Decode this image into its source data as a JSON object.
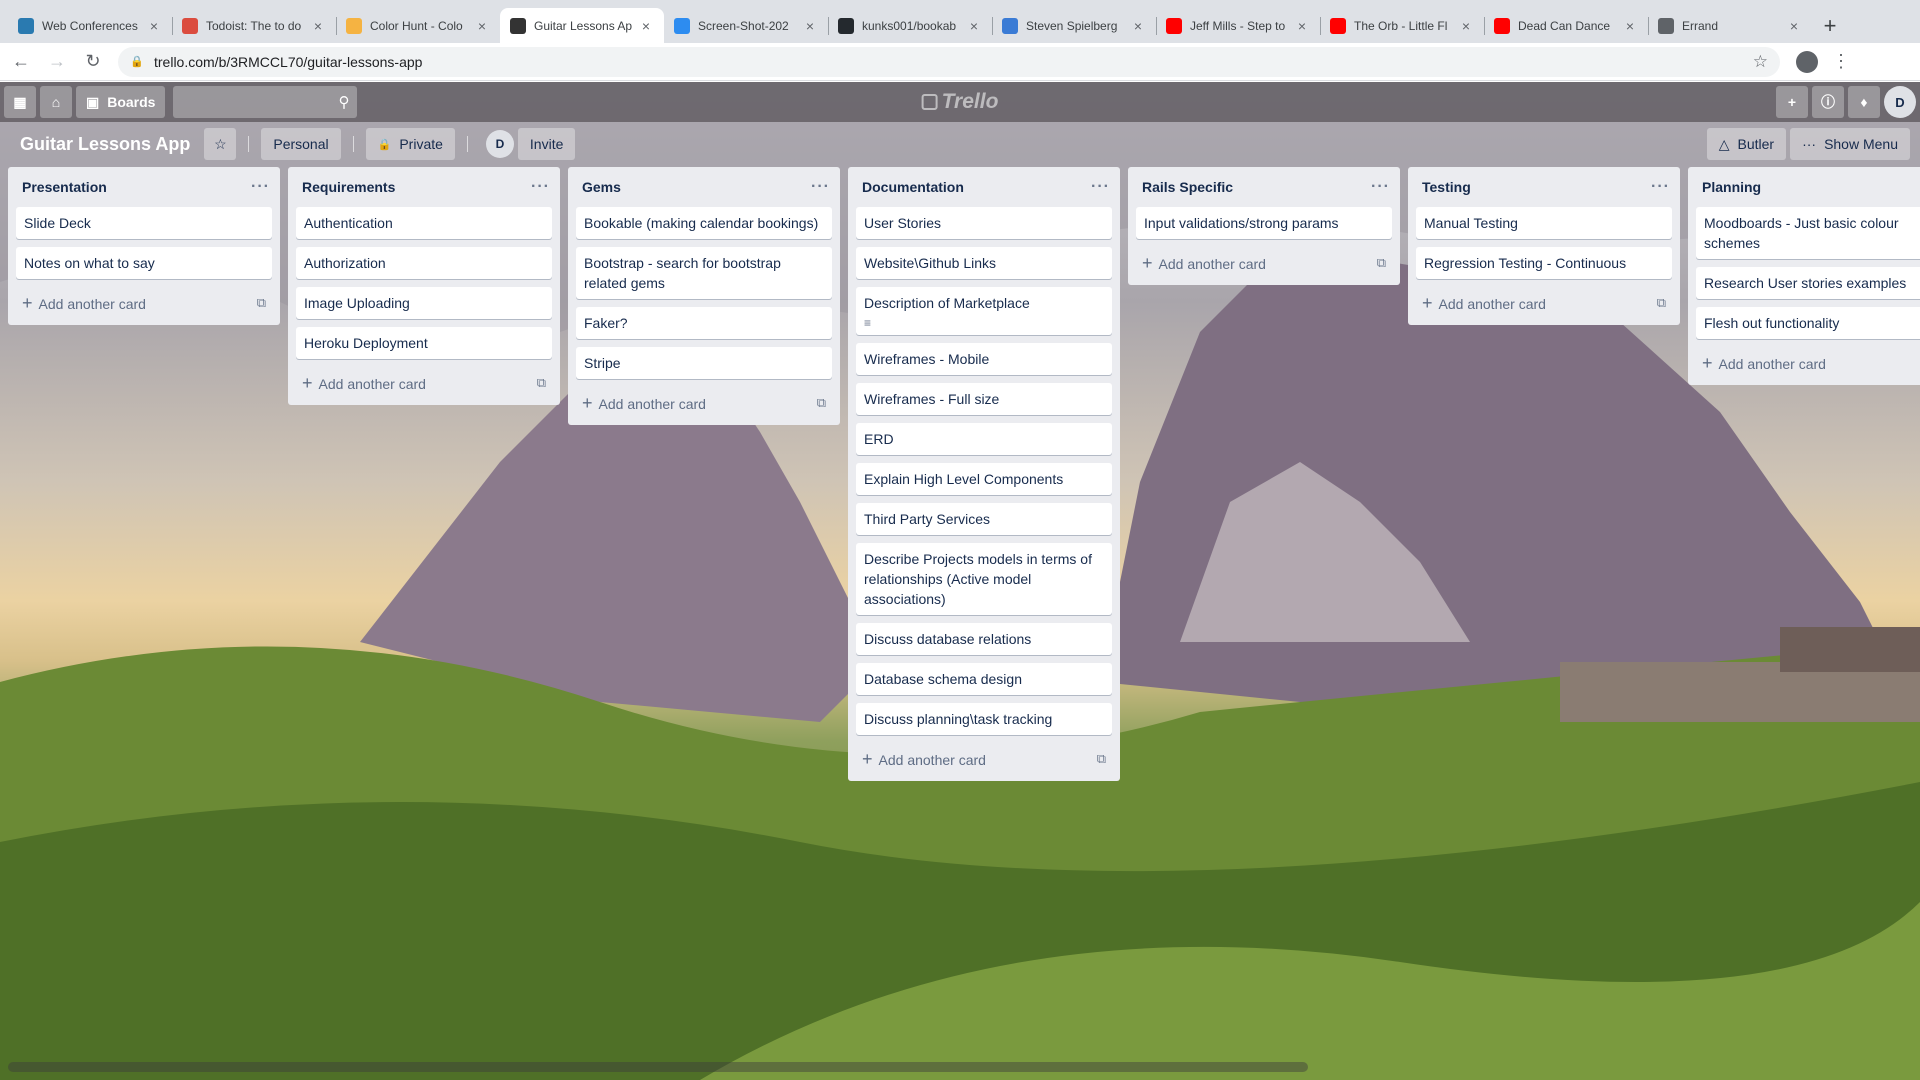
{
  "browser": {
    "tabs": [
      {
        "title": "Web Conferences",
        "icon": "web-conferences-icon",
        "color": "#2a7ab0"
      },
      {
        "title": "Todoist: The to do",
        "icon": "todoist-icon",
        "color": "#db4c3f"
      },
      {
        "title": "Color Hunt - Colo",
        "icon": "color-hunt-icon",
        "color": "#f5b342"
      },
      {
        "title": "Guitar Lessons Ap",
        "icon": "trello-icon",
        "color": "#333333",
        "active": true
      },
      {
        "title": "Screen-Shot-202",
        "icon": "image-host-icon",
        "color": "#2d8cf0"
      },
      {
        "title": "kunks001/bookab",
        "icon": "github-icon",
        "color": "#24292e"
      },
      {
        "title": "Steven Spielberg",
        "icon": "wiki-icon",
        "color": "#3a7bd5"
      },
      {
        "title": "Jeff Mills - Step to",
        "icon": "youtube-icon",
        "color": "#ff0000"
      },
      {
        "title": "The Orb - Little Fl",
        "icon": "youtube-icon",
        "color": "#ff0000"
      },
      {
        "title": "Dead Can Dance",
        "icon": "youtube-icon",
        "color": "#ff0000"
      },
      {
        "title": "Errand",
        "icon": "globe-icon",
        "color": "#5f6368"
      }
    ],
    "url": "trello.com/b/3RMCCL70/guitar-lessons-app"
  },
  "header": {
    "boards_label": "Boards",
    "logo_text": "Trello",
    "avatar_initial": "D"
  },
  "board": {
    "title": "Guitar Lessons App",
    "team_label": "Personal",
    "visibility_label": "Private",
    "member_initial": "D",
    "invite_label": "Invite",
    "butler_label": "Butler",
    "show_menu_label": "Show Menu"
  },
  "add_card_label": "Add another card",
  "lists": [
    {
      "title": "Presentation",
      "cards": [
        {
          "text": "Slide Deck"
        },
        {
          "text": "Notes on what to say"
        }
      ]
    },
    {
      "title": "Requirements",
      "cards": [
        {
          "text": "Authentication"
        },
        {
          "text": "Authorization"
        },
        {
          "text": "Image Uploading"
        },
        {
          "text": "Heroku Deployment"
        }
      ]
    },
    {
      "title": "Gems",
      "cards": [
        {
          "text": "Bookable (making calendar bookings)"
        },
        {
          "text": "Bootstrap - search for bootstrap related gems"
        },
        {
          "text": "Faker?"
        },
        {
          "text": "Stripe"
        }
      ]
    },
    {
      "title": "Documentation",
      "cards": [
        {
          "text": "User Stories"
        },
        {
          "text": "Website\\Github Links"
        },
        {
          "text": "Description of Marketplace",
          "has_description": true
        },
        {
          "text": "Wireframes - Mobile"
        },
        {
          "text": "Wireframes - Full size"
        },
        {
          "text": "ERD"
        },
        {
          "text": "Explain High Level Components"
        },
        {
          "text": "Third Party Services"
        },
        {
          "text": "Describe Projects models in terms of relationships (Active model associations)"
        },
        {
          "text": "Discuss database relations"
        },
        {
          "text": "Database schema design"
        },
        {
          "text": "Discuss planning\\task tracking"
        }
      ]
    },
    {
      "title": "Rails Specific",
      "cards": [
        {
          "text": "Input validations/strong params"
        }
      ]
    },
    {
      "title": "Testing",
      "cards": [
        {
          "text": "Manual Testing"
        },
        {
          "text": "Regression Testing - Continuous"
        }
      ]
    },
    {
      "title": "Planning",
      "cards": [
        {
          "text": "Moodboards - Just basic colour schemes"
        },
        {
          "text": "Research User stories examples"
        },
        {
          "text": "Flesh out functionality"
        }
      ]
    }
  ]
}
